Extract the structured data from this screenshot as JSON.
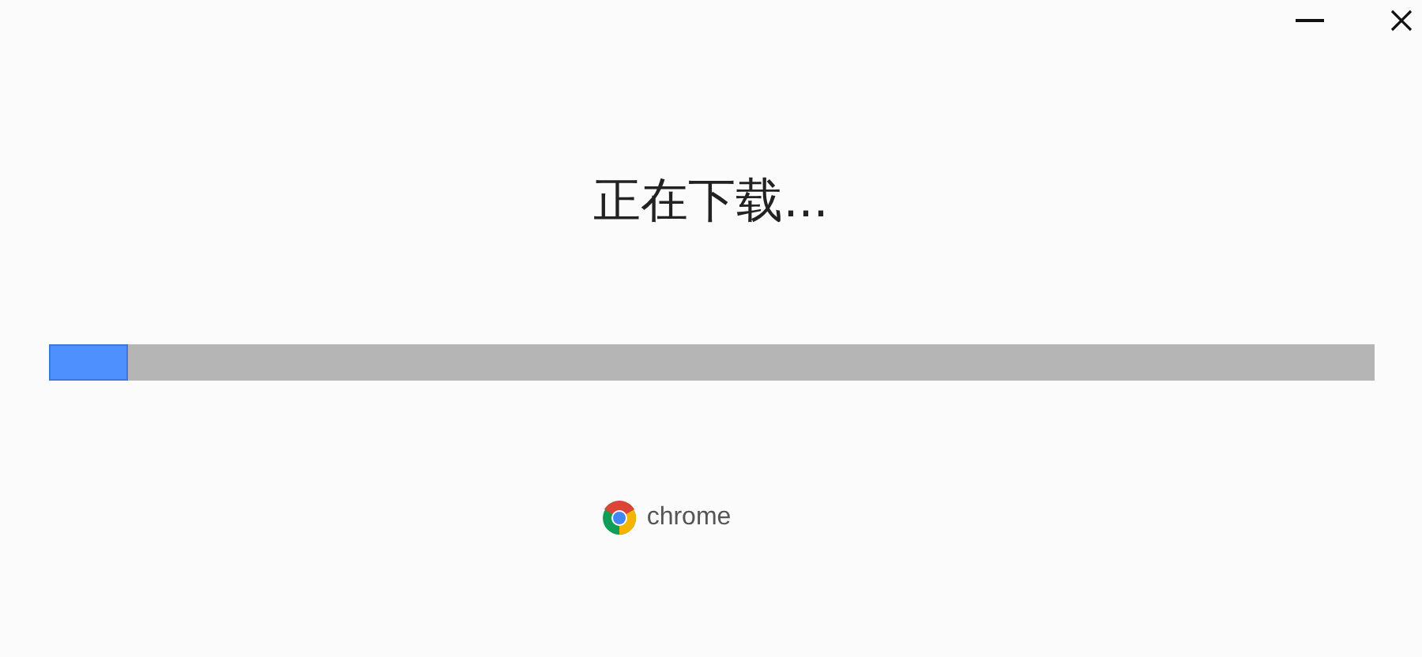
{
  "window": {
    "controls": [
      {
        "kind": "minimize"
      },
      {
        "kind": "close"
      }
    ]
  },
  "heading": "正在下载...",
  "progress": {
    "level": 0.06
  },
  "brand": {
    "name": "chrome"
  }
}
